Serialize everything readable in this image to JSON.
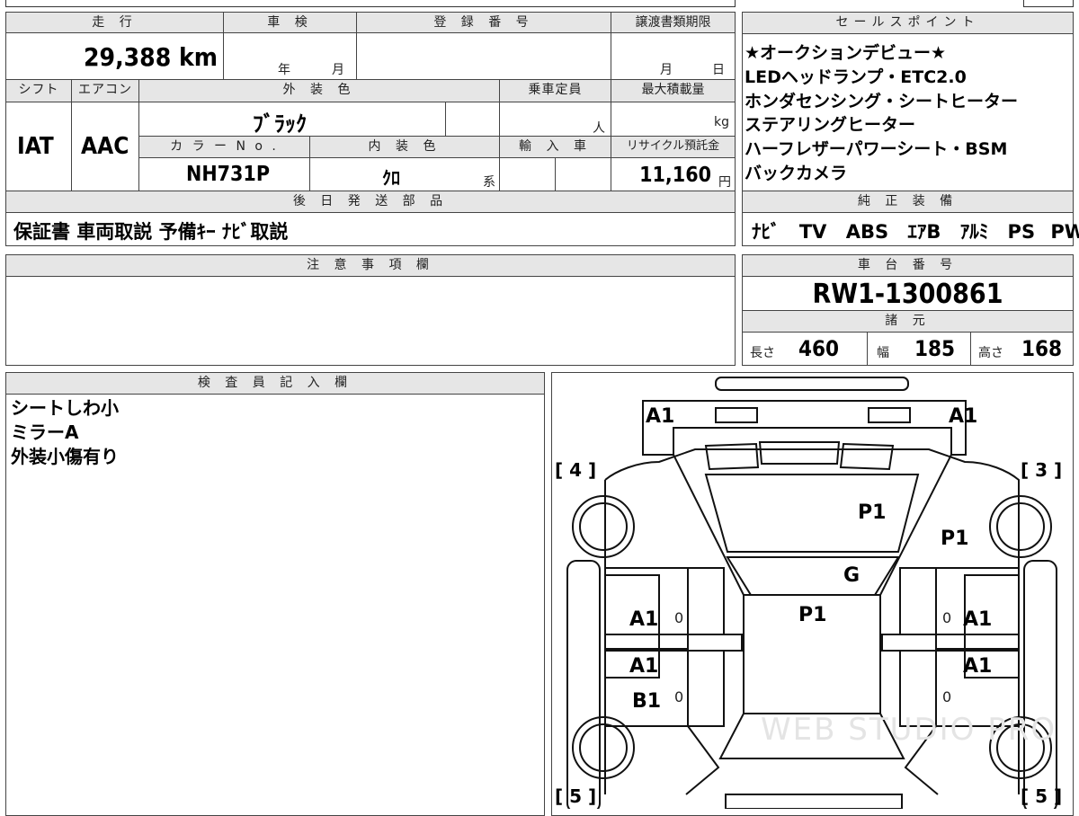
{
  "top_row": {
    "mileage_header": "走 行",
    "shaken_header": "車 検",
    "reg_header": "登 録 番 号",
    "transfer_header": "譲渡書類期限",
    "mileage": "29,388 km",
    "shaken_year": "年",
    "shaken_month": "月",
    "transfer_month": "月",
    "transfer_day": "日"
  },
  "row2": {
    "shift_header": "シフト",
    "aircon_header": "エアコン",
    "exterior_header": "外 装 色",
    "capacity_header": "乗車定員",
    "loadcap_header": "最大積載量",
    "shift": "IAT",
    "aircon": "AAC",
    "exterior_color": "ﾌﾞﾗｯｸ",
    "capacity_unit": "人",
    "loadcap_unit": "kg",
    "colorno_header": "カ ラ ー N o .",
    "interior_header": "内 装 色",
    "import_header": "輸 入 車",
    "recycle_header": "リサイクル預託金",
    "color_no": "NH731P",
    "interior_color": "ｸﾛ",
    "interior_suffix": "系",
    "recycle_fee": "11,160",
    "recycle_unit": "円"
  },
  "later_parts": {
    "header": "後 日 発 送 部 品",
    "items": "保証書 車両取説 予備ｷｰ ﾅﾋﾞ取説"
  },
  "sales_points": {
    "header": "セールスポイント",
    "lines": [
      "★オークションデビュー★",
      "LEDヘッドランプ・ETC2.0",
      "ホンダセンシング・シートヒーター",
      "ステアリングヒーター",
      "ハーフレザーパワーシート・BSM",
      "バックカメラ"
    ]
  },
  "equipment": {
    "header": "純 正 装 備",
    "items": [
      "ﾅﾋﾞ",
      "TV",
      "ABS",
      "ｴｱB",
      "ｱﾙﾐ",
      "PS",
      "PW"
    ]
  },
  "notes": {
    "header": "注 意 事 項 欄",
    "text": ""
  },
  "chassis": {
    "header": "車 台 番 号",
    "number": "RW1-1300861"
  },
  "specs": {
    "header": "諸 元",
    "length_label": "長さ",
    "length": "460",
    "width_label": "幅",
    "width": "185",
    "height_label": "高さ",
    "height": "168"
  },
  "inspector": {
    "header": "検 査 員 記 入 欄",
    "lines": [
      "シートしわ小",
      "ミラーA",
      "外装小傷有り"
    ]
  },
  "diagram": {
    "marks": {
      "front_left_bumper": "A1",
      "front_right_bumper": "A1",
      "hood": "P1",
      "right_fender": "P1",
      "windshield": "G",
      "roof": "P1",
      "left_front_door": "A1",
      "right_front_door": "A1",
      "left_rear_door": "A1",
      "left_rear_door_2": "B1",
      "right_rear_door": "A1"
    },
    "tire_labels": {
      "front_left": "[ 4 ]",
      "front_right": "[ 3 ]",
      "rear_left": "[ 5 ]",
      "rear_right": "[ 5 ]"
    },
    "zero": "0",
    "watermark": "WEB STUDIO PRO"
  }
}
